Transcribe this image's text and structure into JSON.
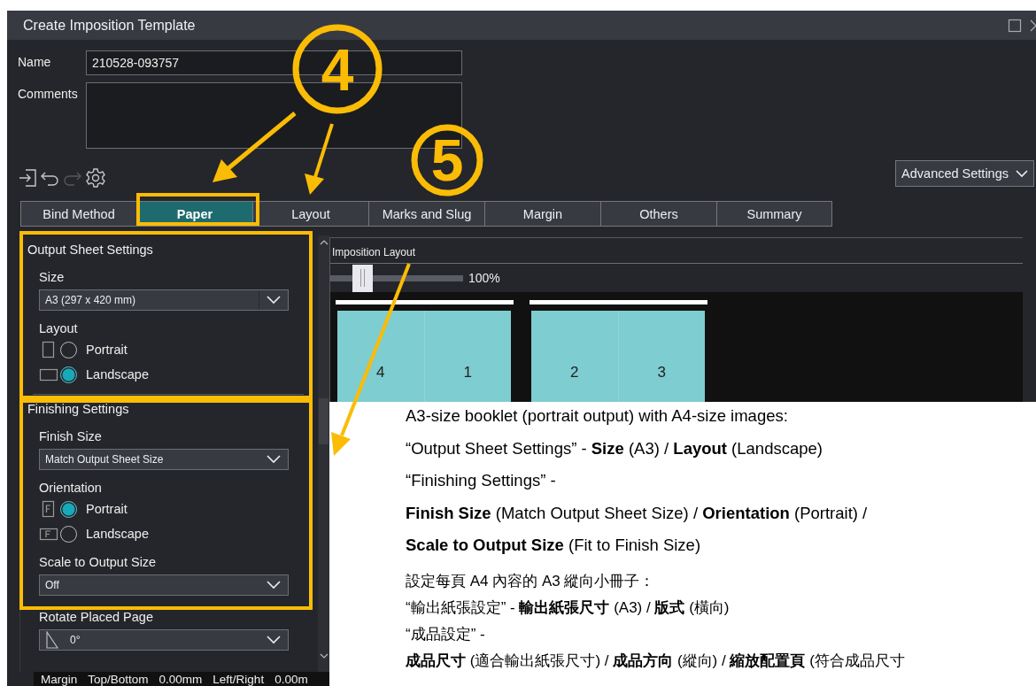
{
  "window": {
    "title": "Create Imposition Template"
  },
  "name_field": {
    "label": "Name",
    "value": "210528-093757"
  },
  "comments_field": {
    "label": "Comments"
  },
  "toolbar": [
    {
      "kind": "export",
      "disabled": false
    },
    {
      "kind": "undo",
      "disabled": false
    },
    {
      "kind": "redo",
      "disabled": true
    },
    {
      "kind": "settings",
      "disabled": false
    }
  ],
  "advanced_settings": {
    "label": "Advanced Settings"
  },
  "tabs": [
    {
      "label": "Bind Method",
      "selected": false
    },
    {
      "label": "Paper",
      "selected": true
    },
    {
      "label": "Layout",
      "selected": false
    },
    {
      "label": "Marks and Slug",
      "selected": false
    },
    {
      "label": "Margin",
      "selected": false
    },
    {
      "label": "Others",
      "selected": false
    },
    {
      "label": "Summary",
      "selected": false
    }
  ],
  "output_sheet": {
    "title": "Output Sheet Settings",
    "size_label": "Size",
    "size_value": "A3 (297 x 420 mm)",
    "layout_label": "Layout",
    "layout_options": [
      {
        "label": "Portrait",
        "kind": "portrait",
        "selected": false
      },
      {
        "label": "Landscape",
        "kind": "landscape",
        "selected": true
      }
    ]
  },
  "finishing": {
    "title": "Finishing Settings",
    "finish_size_label": "Finish Size",
    "finish_size_value": "Match Output Sheet Size",
    "orientation_label": "Orientation",
    "orientation_options": [
      {
        "label": "Portrait",
        "kind": "portrait",
        "selected": true
      },
      {
        "label": "Landscape",
        "kind": "landscape",
        "selected": false
      }
    ],
    "scale_label": "Scale to Output Size",
    "scale_value": "Off"
  },
  "rotate": {
    "label": "Rotate Placed Page",
    "value": "0°"
  },
  "margin_bar": {
    "label": "Margin",
    "items": [
      {
        "label": "Top/Bottom",
        "value": "0.00mm"
      },
      {
        "label": "Left/Right",
        "value": "0.00m"
      }
    ]
  },
  "imposition": {
    "title": "Imposition Layout",
    "zoom": {
      "level": 0.2,
      "reading": "100%"
    },
    "sheets": [
      {
        "pages": [
          "4",
          "1"
        ]
      },
      {
        "pages": [
          "2",
          "3"
        ]
      }
    ]
  },
  "markers": [
    {
      "number": "4"
    },
    {
      "number": "5"
    }
  ],
  "notes": {
    "english": [
      "A3-size booklet (portrait output) with A4-size images:",
      "“Output Sheet Settings” - **Size** (A3) / **Layout** (Landscape)",
      "“Finishing Settings” -",
      "**Finish Size** (Match Output Sheet Size) / **Orientation** (Portrait) /",
      "**Scale to Output Size** (Fit to Finish Size)"
    ],
    "chinese": [
      "設定每頁 A4 內容的 A3 縱向小冊子：",
      "“輸出紙張設定” - **輸出紙張尺寸** (A3) / **版式** (橫向)",
      "“成品設定” -",
      "**成品尺寸** (適合輸出紙張尺寸) / **成品方向** (縱向) / **縮放配置頁** (符合成品尺寸"
    ]
  }
}
